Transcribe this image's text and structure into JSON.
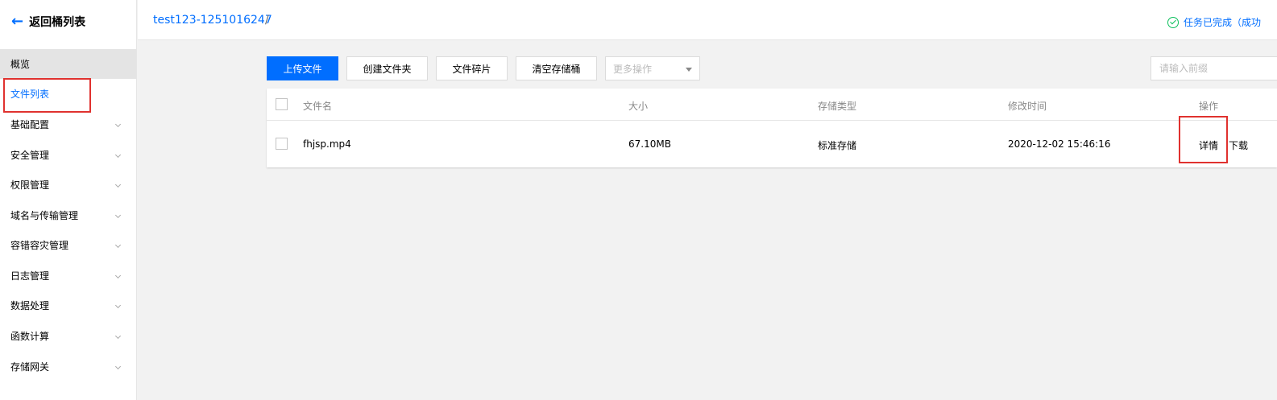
{
  "sidebar": {
    "back_label": "返回桶列表",
    "items": [
      {
        "label": "概览",
        "expandable": false
      },
      {
        "label": "文件列表",
        "expandable": false,
        "active": true
      },
      {
        "label": "基础配置",
        "expandable": true
      },
      {
        "label": "安全管理",
        "expandable": true
      },
      {
        "label": "权限管理",
        "expandable": true
      },
      {
        "label": "域名与传输管理",
        "expandable": true
      },
      {
        "label": "容错容灾管理",
        "expandable": true
      },
      {
        "label": "日志管理",
        "expandable": true
      },
      {
        "label": "数据处理",
        "expandable": true
      },
      {
        "label": "函数计算",
        "expandable": true
      },
      {
        "label": "存储网关",
        "expandable": true
      }
    ]
  },
  "header": {
    "bucket": "test123-1251016247",
    "separator": "/",
    "task_status": "任务已完成（成功"
  },
  "toolbar": {
    "upload": "上传文件",
    "create_folder": "创建文件夹",
    "fragments": "文件碎片",
    "clear_bucket": "清空存储桶",
    "more_placeholder": "更多操作",
    "search_placeholder": "请输入前缀"
  },
  "table": {
    "headers": {
      "name": "文件名",
      "size": "大小",
      "storage": "存储类型",
      "modified": "修改时间",
      "actions": "操作"
    },
    "rows": [
      {
        "name": "fhjsp.mp4",
        "size": "67.10MB",
        "storage": "标准存储",
        "modified": "2020-12-02 15:46:16",
        "detail": "详情",
        "download": "下载"
      }
    ]
  },
  "colors": {
    "accent": "#006eff",
    "highlight": "#e0322f",
    "success": "#0abf5b"
  }
}
